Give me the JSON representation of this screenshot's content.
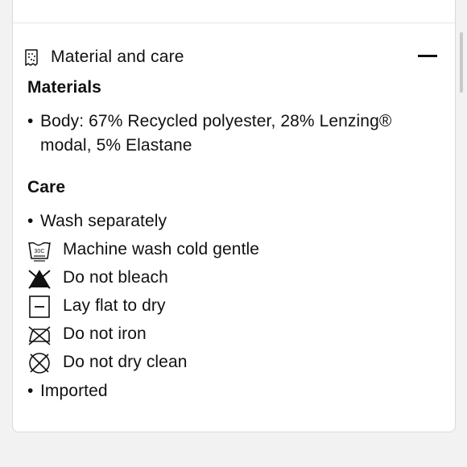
{
  "section": {
    "title": "Material and care",
    "collapse_symbol": "—"
  },
  "materials": {
    "heading": "Materials",
    "items": [
      "Body: 67% Recycled polyester, 28% Lenzing® modal, 5% Elastane"
    ]
  },
  "care": {
    "heading": "Care",
    "items": [
      {
        "icon": "bullet",
        "text": "Wash separately"
      },
      {
        "icon": "machine-wash-30c-icon",
        "text": "Machine wash cold gentle"
      },
      {
        "icon": "do-not-bleach-icon",
        "text": "Do not bleach"
      },
      {
        "icon": "lay-flat-dry-icon",
        "text": "Lay flat to dry"
      },
      {
        "icon": "do-not-iron-icon",
        "text": "Do not iron"
      },
      {
        "icon": "do-not-dry-clean-icon",
        "text": "Do not dry clean"
      },
      {
        "icon": "bullet",
        "text": "Imported"
      }
    ],
    "wash_temp_label": "30C"
  },
  "colors": {
    "background": "#f2f2f2",
    "card": "#ffffff",
    "text": "#111111",
    "border": "#d9d9d9"
  }
}
